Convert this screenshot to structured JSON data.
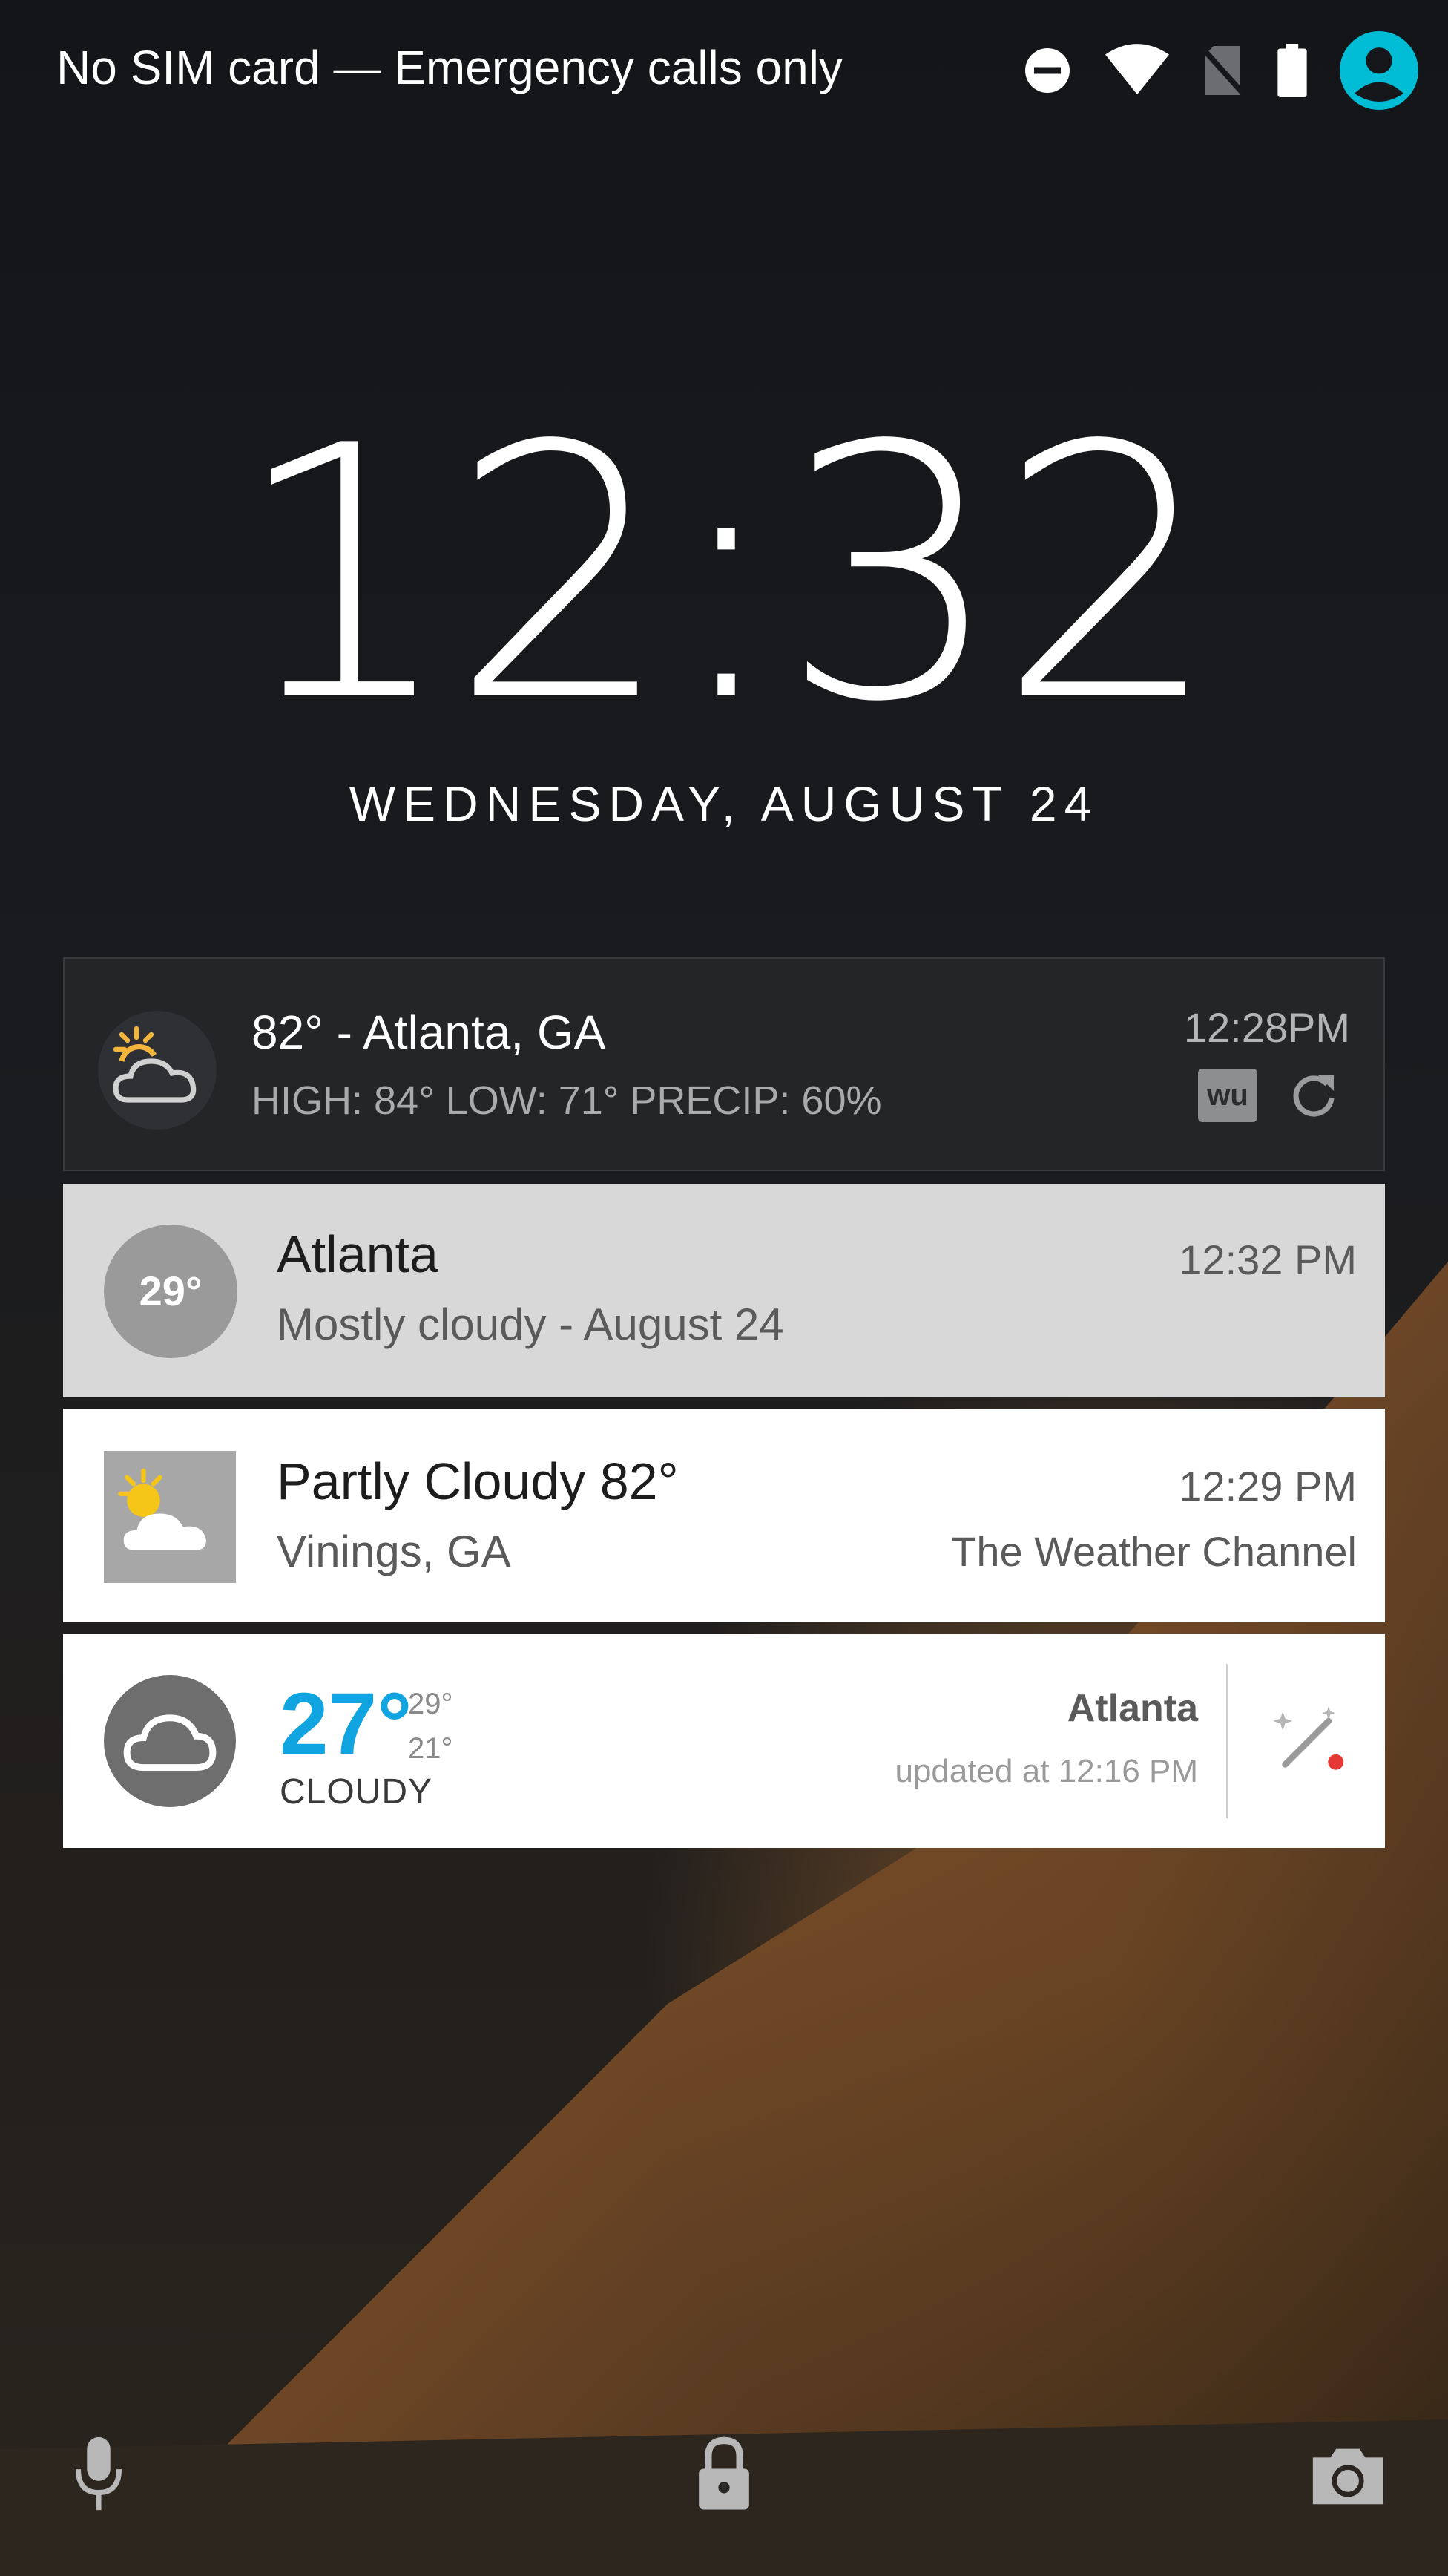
{
  "status_bar": {
    "carrier_text": "No SIM card — Emergency calls only",
    "icons": [
      "do-not-disturb-icon",
      "wifi-icon",
      "no-sim-icon",
      "battery-icon",
      "user-avatar-icon"
    ],
    "accent_color": "#00bcd4"
  },
  "clock": {
    "time": "12:32",
    "date": "WEDNESDAY, AUGUST 24"
  },
  "notifications": [
    {
      "icon": "partly-cloudy-icon",
      "title": "82° - Atlanta, GA",
      "subtitle": "HIGH: 84° LOW: 71° PRECIP: 60%",
      "time": "12:28PM",
      "brand_label": "wu",
      "action_icon": "refresh-icon"
    },
    {
      "badge": "29°",
      "title": "Atlanta",
      "subtitle": "Mostly cloudy - August 24",
      "time": "12:32 PM"
    },
    {
      "icon": "partly-cloudy-sun-icon",
      "title": "Partly Cloudy 82°",
      "subtitle": "Vinings, GA",
      "time": "12:29 PM",
      "source": "The Weather Channel"
    },
    {
      "icon": "cloud-icon",
      "temperature": "27°",
      "high": "29°",
      "low": "21°",
      "condition": "CLOUDY",
      "city": "Atlanta",
      "updated": "updated at 12:16 PM",
      "action_icon": "magic-wand-icon",
      "temp_color": "#10a5e0"
    }
  ],
  "bottom_bar": {
    "icons": [
      "microphone-icon",
      "lock-icon",
      "camera-icon"
    ]
  }
}
